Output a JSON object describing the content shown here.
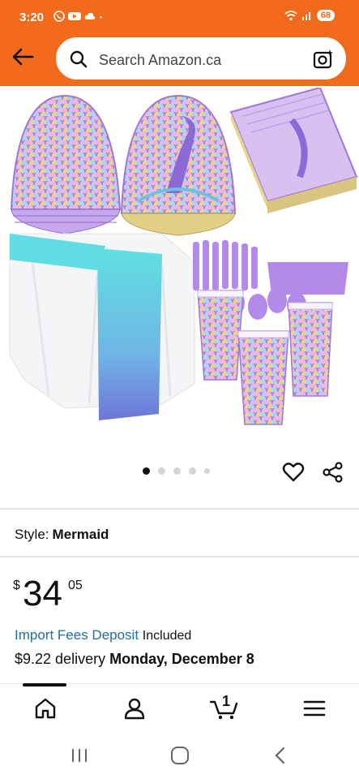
{
  "status_bar": {
    "time": "3:20",
    "battery": "68"
  },
  "search": {
    "placeholder": "Search Amazon.ca"
  },
  "carousel": {
    "pages": 5,
    "active_index": 0
  },
  "product": {
    "style_label": "Style:",
    "style_value": "Mermaid",
    "price_currency": "$",
    "price_whole": "34",
    "price_fraction": "05",
    "import_fees_link": "Import Fees Deposit",
    "import_fees_status": "Included",
    "delivery_text": "$9.22 delivery",
    "delivery_date": "Monday, December 8"
  },
  "bottom_nav": {
    "cart_count": "1",
    "items": [
      "home",
      "account",
      "cart",
      "menu"
    ]
  },
  "colors": {
    "header": "#f26b1d",
    "link": "#1f6f99",
    "purple_main": "#b58ee6",
    "teal_runner": "#4fc8d8"
  }
}
